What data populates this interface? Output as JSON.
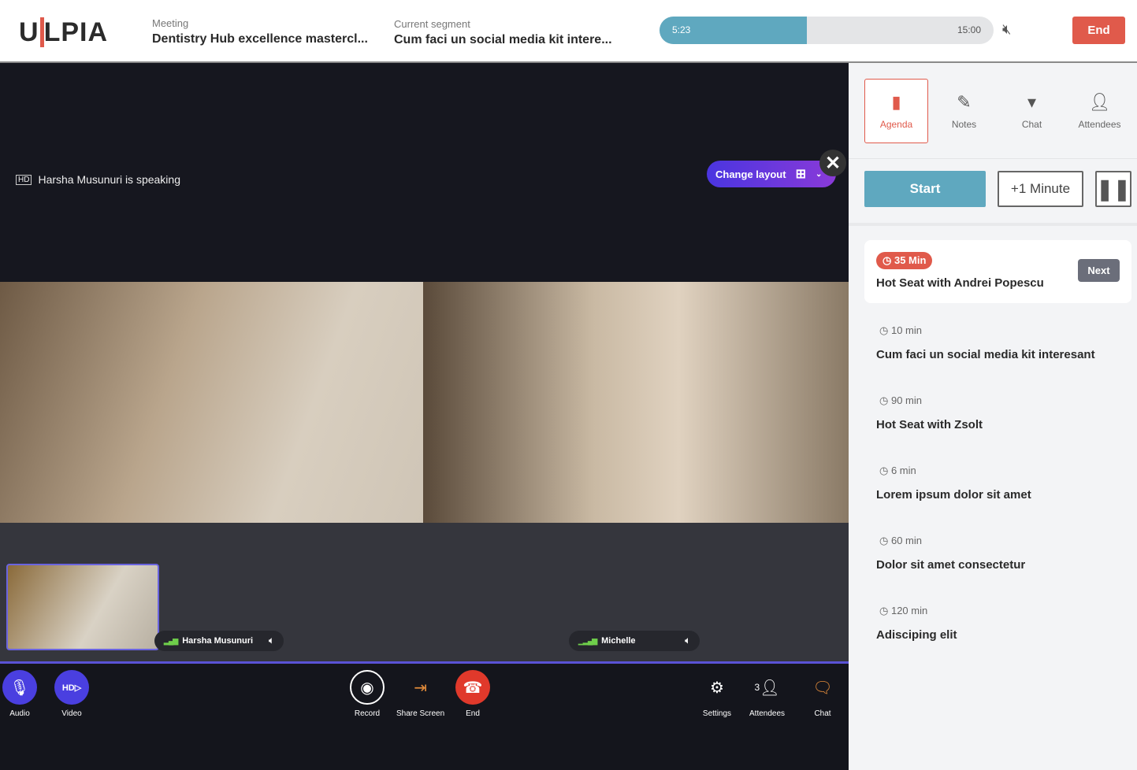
{
  "header": {
    "logo": "ULPIA",
    "meeting_label": "Meeting",
    "meeting_title": "Dentistry Hub excellence mastercl...",
    "segment_label": "Current segment",
    "segment_title": "Cum faci un social media kit intere...",
    "elapsed": "5:23",
    "total": "15:00",
    "progress_percent": 44,
    "end_label": "End"
  },
  "video": {
    "speaking": "Harsha Musunuri is speaking",
    "change_layout": "Change layout",
    "participants": [
      {
        "name": "Harsha Musunuri"
      },
      {
        "name": "Michelle"
      }
    ]
  },
  "controls": {
    "audio": "Audio",
    "video": "Video",
    "record": "Record",
    "share": "Share Screen",
    "end": "End",
    "settings": "Settings",
    "attendees": "Attendees",
    "attendee_count": "3",
    "chat": "Chat"
  },
  "sidebar": {
    "tabs": [
      {
        "label": "Agenda",
        "icon": "notebook-icon"
      },
      {
        "label": "Notes",
        "icon": "pencil-icon"
      },
      {
        "label": "Chat",
        "icon": "chat-icon"
      },
      {
        "label": "Attendees",
        "icon": "users-icon"
      }
    ],
    "start": "Start",
    "plus_minute": "+1 Minute",
    "current": {
      "duration": "35 Min",
      "title": "Hot Seat with Andrei Popescu",
      "next": "Next"
    },
    "items": [
      {
        "duration": "10 min",
        "title": "Cum faci un social media kit interesant"
      },
      {
        "duration": "90 min",
        "title": "Hot Seat with Zsolt"
      },
      {
        "duration": "6 min",
        "title": "Lorem ipsum dolor sit amet"
      },
      {
        "duration": "60 min",
        "title": "Dolor sit amet consectetur"
      },
      {
        "duration": "120 min",
        "title": "Adisciping elit"
      }
    ]
  },
  "colors": {
    "accent": "#e05a4b",
    "progress": "#5fa8bf",
    "control_blue": "#4a3fe0"
  }
}
